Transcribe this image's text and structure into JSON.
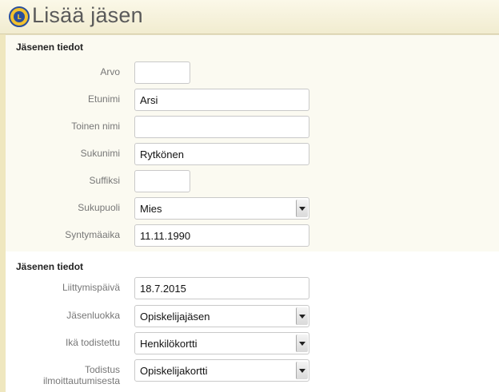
{
  "header": {
    "title": "Lisää jäsen",
    "logo_icon": "lions-club-logo-icon"
  },
  "colors": {
    "header_bg": "#f4efd8",
    "section_bg": "#fbfaf1",
    "label": "#777777"
  },
  "section1": {
    "title": "Jäsenen tiedot",
    "fields": [
      {
        "label": "Arvo",
        "value": ""
      },
      {
        "label": "Etunimi",
        "value": "Arsi"
      },
      {
        "label": "Toinen nimi",
        "value": ""
      },
      {
        "label": "Sukunimi",
        "value": "Rytkönen"
      },
      {
        "label": "Suffiksi",
        "value": ""
      },
      {
        "label": "Sukupuoli",
        "value": "Mies"
      },
      {
        "label": "Syntymäaika",
        "value": "11.11.1990"
      }
    ]
  },
  "section2": {
    "title": "Jäsenen tiedot",
    "fields": [
      {
        "label": "Liittymispäivä",
        "value": "18.7.2015"
      },
      {
        "label": "Jäsenluokka",
        "value": "Opiskelijajäsen"
      },
      {
        "label": "Ikä todistettu",
        "value": "Henkilökortti"
      },
      {
        "label_line1": "Todistus",
        "label_line2": "ilmoittautumisesta",
        "value": "Opiskelijakortti"
      }
    ]
  }
}
